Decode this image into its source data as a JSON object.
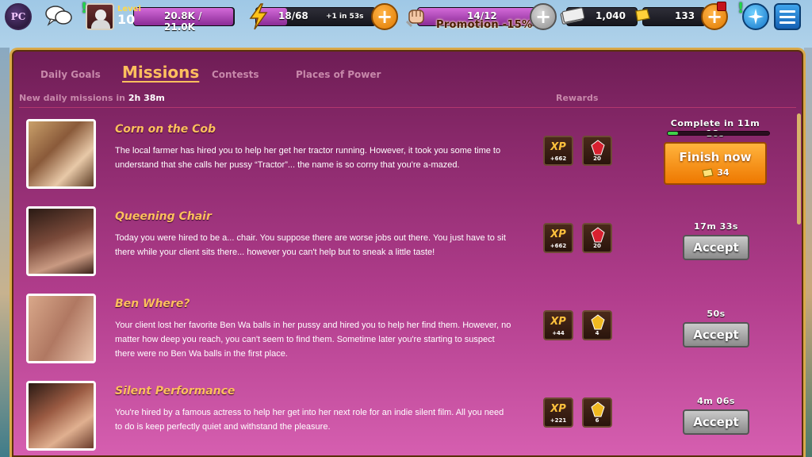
{
  "hud": {
    "logo_text": "PC",
    "level_label": "Level",
    "level": "10",
    "xp_text": "20.8K / 21.0K",
    "xp_progress": 0.99,
    "energy_text": "18/68",
    "energy_regen": "+1 in 53s",
    "energy_progress": 0.26,
    "promo_text": "14/12",
    "promo_label": "Promotion -15%",
    "promo_progress": 1.0,
    "cash": "1,040",
    "gold": "133"
  },
  "tabs": [
    {
      "label": "Daily Goals",
      "active": false
    },
    {
      "label": "Missions",
      "active": true
    },
    {
      "label": "Contests",
      "active": false
    },
    {
      "label": "Places of Power",
      "active": false
    }
  ],
  "subheader": {
    "refresh_label": "New daily missions in",
    "refresh_time": "2h 38m",
    "rewards_label": "Rewards"
  },
  "missions": [
    {
      "title": "Corn on the Cob",
      "description": "The local farmer has hired you to help her get her tractor running. However, it took you some time to understand that she calls her pussy “Tractor”... the name is so corny that you're a-mazed.",
      "xp_label": "XP",
      "xp": "+662",
      "gems": "20",
      "gem_color": "#d8202f",
      "timer": "Complete in 11m 18s",
      "progress": 0.1,
      "button": "Finish now",
      "cost": "34"
    },
    {
      "title": "Queening Chair",
      "description": "Today you were hired to be a... chair. You suppose there are worse jobs out there. You just have to sit there while your client sits there... however you can't help but to sneak a little taste!",
      "xp_label": "XP",
      "xp": "+662",
      "gems": "20",
      "gem_color": "#d8202f",
      "timer": "17m 33s",
      "button": "Accept"
    },
    {
      "title": "Ben Where?",
      "description": "Your client lost her favorite Ben Wa balls in her pussy and hired you to help her find them. However, no matter how deep you reach, you can't seem to find them. Sometime later you're starting to suspect there were no Ben Wa balls in the first place.",
      "xp_label": "XP",
      "xp": "+44",
      "gems": "4",
      "gem_color": "#f0b820",
      "timer": "50s",
      "button": "Accept"
    },
    {
      "title": "Silent Performance",
      "description": "You're hired by a famous actress to help her get into her next role for an indie silent film. All you need to do is keep perfectly quiet and withstand the pleasure.",
      "xp_label": "XP",
      "xp": "+221",
      "gems": "6",
      "gem_color": "#f0b820",
      "timer": "4m 06s",
      "button": "Accept"
    }
  ]
}
